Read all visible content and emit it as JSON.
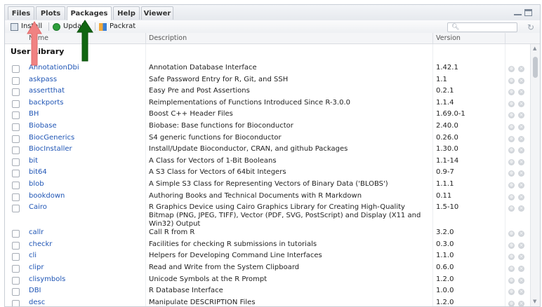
{
  "tabs": [
    {
      "label": "Files",
      "active": false
    },
    {
      "label": "Plots",
      "active": false
    },
    {
      "label": "Packages",
      "active": true
    },
    {
      "label": "Help",
      "active": false
    },
    {
      "label": "Viewer",
      "active": false
    }
  ],
  "toolbar": {
    "install_label": "Install",
    "update_label": "Update",
    "packrat_label": "Packrat",
    "search_placeholder": ""
  },
  "table": {
    "headers": {
      "name": "Name",
      "description": "Description",
      "version": "Version"
    },
    "group_label": "User Library",
    "rows": [
      {
        "name": "AnnotationDbi",
        "description": "Annotation Database Interface",
        "version": "1.42.1"
      },
      {
        "name": "askpass",
        "description": "Safe Password Entry for R, Git, and SSH",
        "version": "1.1"
      },
      {
        "name": "assertthat",
        "description": "Easy Pre and Post Assertions",
        "version": "0.2.1"
      },
      {
        "name": "backports",
        "description": "Reimplementations of Functions Introduced Since R-3.0.0",
        "version": "1.1.4"
      },
      {
        "name": "BH",
        "description": "Boost C++ Header Files",
        "version": "1.69.0-1"
      },
      {
        "name": "Biobase",
        "description": "Biobase: Base functions for Bioconductor",
        "version": "2.40.0"
      },
      {
        "name": "BiocGenerics",
        "description": "S4 generic functions for Bioconductor",
        "version": "0.26.0"
      },
      {
        "name": "BiocInstaller",
        "description": "Install/Update Bioconductor, CRAN, and github Packages",
        "version": "1.30.0"
      },
      {
        "name": "bit",
        "description": "A Class for Vectors of 1-Bit Booleans",
        "version": "1.1-14"
      },
      {
        "name": "bit64",
        "description": "A S3 Class for Vectors of 64bit Integers",
        "version": "0.9-7"
      },
      {
        "name": "blob",
        "description": "A Simple S3 Class for Representing Vectors of Binary Data ('BLOBS')",
        "version": "1.1.1"
      },
      {
        "name": "bookdown",
        "description": "Authoring Books and Technical Documents with R Markdown",
        "version": "0.11"
      },
      {
        "name": "Cairo",
        "description": "R Graphics Device using Cairo Graphics Library for Creating High-Quality Bitmap (PNG, JPEG, TIFF), Vector (PDF, SVG, PostScript) and Display (X11 and Win32) Output",
        "version": "1.5-10"
      },
      {
        "name": "callr",
        "description": "Call R from R",
        "version": "3.2.0"
      },
      {
        "name": "checkr",
        "description": "Facilities for checking R submissions in tutorials",
        "version": "0.3.0"
      },
      {
        "name": "cli",
        "description": "Helpers for Developing Command Line Interfaces",
        "version": "1.1.0"
      },
      {
        "name": "clipr",
        "description": "Read and Write from the System Clipboard",
        "version": "0.6.0"
      },
      {
        "name": "clisymbols",
        "description": "Unicode Symbols at the R Prompt",
        "version": "1.2.0"
      },
      {
        "name": "DBI",
        "description": "R Database Interface",
        "version": "1.0.0"
      },
      {
        "name": "desc",
        "description": "Manipulate DESCRIPTION Files",
        "version": "1.2.0"
      }
    ]
  },
  "icons": {
    "install": "install-icon",
    "update": "update-icon",
    "packrat": "packrat-icon",
    "search": "search-icon",
    "refresh": "refresh-icon",
    "web": "globe-icon",
    "remove": "remove-icon"
  },
  "colors": {
    "package_link": "#1f55b5",
    "update_icon": "#2e9e3b",
    "red_arrow": "#f08282",
    "green_arrow": "#116611"
  }
}
